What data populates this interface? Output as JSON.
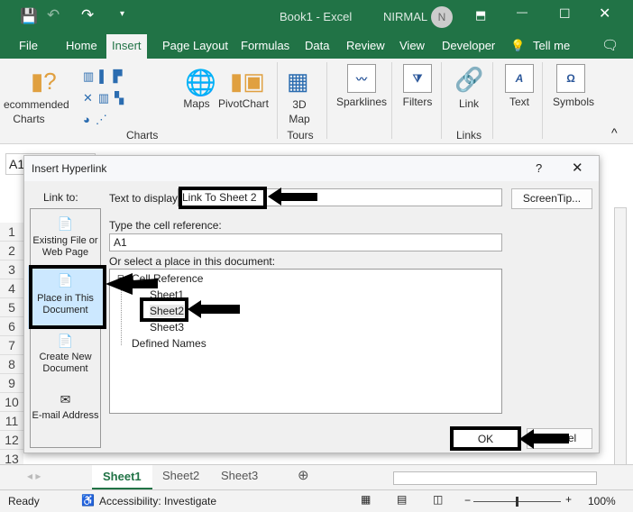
{
  "window": {
    "title": "Book1  -  Excel",
    "user": "NIRMAL",
    "avatar_initial": "N"
  },
  "menu_tabs": [
    "File",
    "Home",
    "Insert",
    "Page Layout",
    "Formulas",
    "Data",
    "Review",
    "View",
    "Developer",
    "Tell me"
  ],
  "ribbon": {
    "recommended_charts": "ecommended Charts",
    "maps": "Maps",
    "pivotchart": "PivotChart",
    "map3d": "3D Map",
    "sparklines": "Sparklines",
    "filters": "Filters",
    "link": "Link",
    "text": "Text",
    "symbols": "Symbols",
    "groups": {
      "charts": "Charts",
      "tours": "Tours",
      "links": "Links"
    }
  },
  "name_box": "A1",
  "rows": [
    "1",
    "2",
    "3",
    "4",
    "5",
    "6",
    "7",
    "8",
    "9",
    "10",
    "11",
    "12",
    "13"
  ],
  "dialog": {
    "title": "Insert Hyperlink",
    "help": "?",
    "link_to": "Link to:",
    "link_options": [
      "Existing File or Web Page",
      "Place in This Document",
      "Create New Document",
      "E-mail Address"
    ],
    "text_to_display_label": "Text to display:",
    "text_to_display": "Link To Sheet 2",
    "screentip": "ScreenTip...",
    "cell_ref_label": "Type the cell reference:",
    "cell_ref": "A1",
    "select_label": "Or select a place in this document:",
    "tree": {
      "cell_reference": "Cell Reference",
      "sheets": [
        "Sheet1",
        "Sheet2",
        "Sheet3"
      ],
      "defined_names": "Defined Names"
    },
    "ok": "OK",
    "cancel": "Cancel"
  },
  "sheet_tabs": [
    "Sheet1",
    "Sheet2",
    "Sheet3"
  ],
  "status": {
    "ready": "Ready",
    "accessibility": "Accessibility: Investigate",
    "zoom": "100%"
  },
  "colors": {
    "excel_green": "#217346",
    "selected_panel": "#cce8ff"
  }
}
